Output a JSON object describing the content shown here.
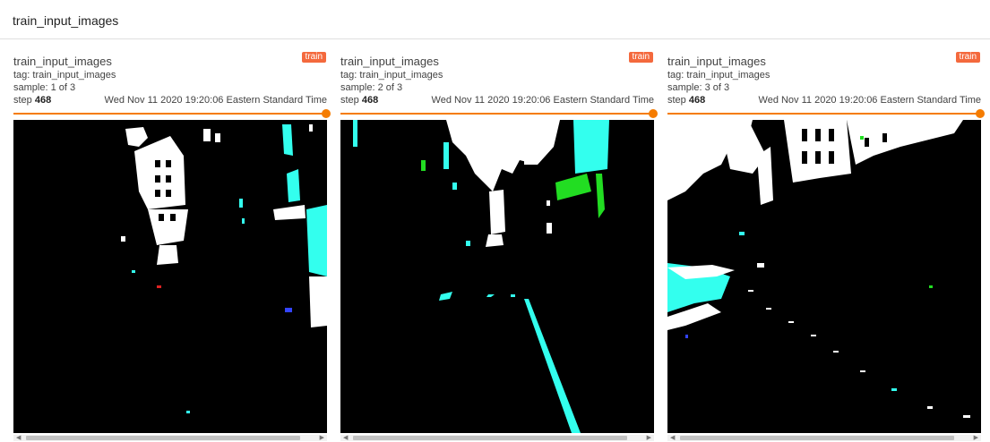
{
  "section": {
    "title": "train_input_images"
  },
  "cards": [
    {
      "title": "train_input_images",
      "run": "train",
      "tag": "tag: train_input_images",
      "sample": "sample: 1 of 3",
      "step_label": "step",
      "step_value": "468",
      "timestamp": "Wed Nov 11 2020 19:20:06 Eastern Standard Time",
      "slider_value": 1.0
    },
    {
      "title": "train_input_images",
      "run": "train",
      "tag": "tag: train_input_images",
      "sample": "sample: 2 of 3",
      "step_label": "step",
      "step_value": "468",
      "timestamp": "Wed Nov 11 2020 19:20:06 Eastern Standard Time",
      "slider_value": 1.0
    },
    {
      "title": "train_input_images",
      "run": "train",
      "tag": "tag: train_input_images",
      "sample": "sample: 3 of 3",
      "step_label": "step",
      "step_value": "468",
      "timestamp": "Wed Nov 11 2020 19:20:06 Eastern Standard Time",
      "slider_value": 1.0
    }
  ],
  "colors": {
    "run_badge": "#f4693d",
    "slider": "#f57c00",
    "image_background": "#000000",
    "image_highlight": "#ffffff",
    "image_cyan": "#33ffee",
    "image_green": "#22dd22"
  },
  "icons": {
    "scroll_left": "triangle-left",
    "scroll_right": "triangle-right"
  }
}
